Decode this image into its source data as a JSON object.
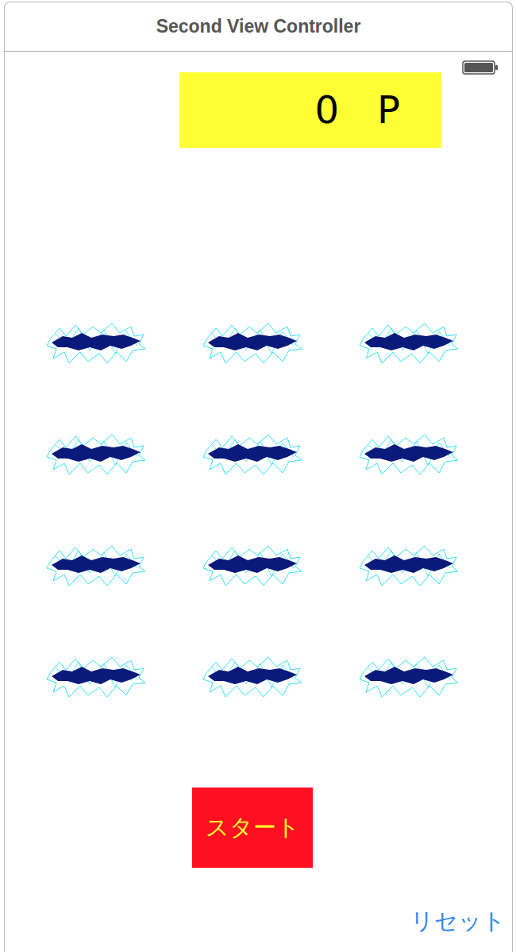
{
  "window": {
    "title": "Second View Controller"
  },
  "status_bar": {
    "battery": {
      "level": 1
    }
  },
  "score": "0　P",
  "buttons": {
    "start": "スタート",
    "reset": "リセット"
  }
}
